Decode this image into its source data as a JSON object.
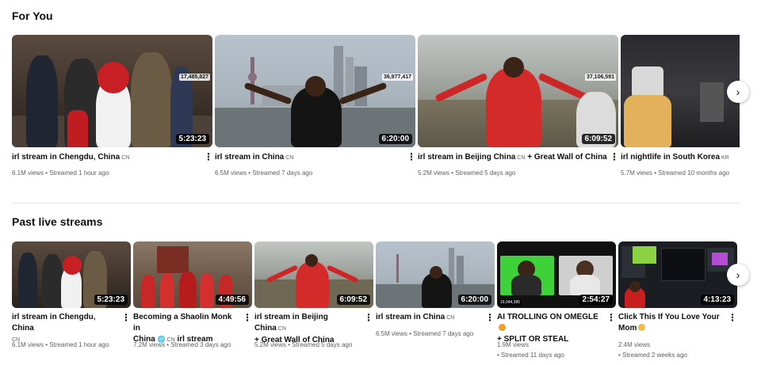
{
  "sections": {
    "for_you": {
      "title": "For You",
      "videos": [
        {
          "title": "irl stream in Chengdu, China",
          "country": "CN",
          "duration": "5:23:23",
          "counter": "17,485,827",
          "meta": "6.1M views • Streamed 1 hour ago"
        },
        {
          "title": "irl stream in China",
          "country": "CN",
          "duration": "6:20:00",
          "counter": "36,977,417",
          "meta": "6.5M views • Streamed 7 days ago"
        },
        {
          "title": "irl stream in Beijing China",
          "country": "CN",
          "title_rest": "+ Great Wall of China",
          "duration": "6:09:52",
          "counter": "37,106,591",
          "meta": "5.2M views • Streamed 5 days ago"
        },
        {
          "title": "irl nightlife in South Korea",
          "country": "KR",
          "meta": "5.7M views • Streamed 10 months ago"
        }
      ]
    },
    "past_live": {
      "title": "Past live streams",
      "videos": [
        {
          "title": "irl stream in Chengdu, China",
          "country": "CN",
          "duration": "5:23:23",
          "meta": "6.1M views • Streamed 1 hour ago"
        },
        {
          "title_a": "Becoming a Shaolin Monk in",
          "title_b": "China",
          "globe": "🌐",
          "country": "CN",
          "title_c": "irl stream",
          "duration": "4:49:56",
          "meta": "7.2M views • Streamed 3 days ago"
        },
        {
          "title": "irl stream in Beijing China",
          "country": "CN",
          "title_rest": "+ Great Wall of China",
          "duration": "6:09:52",
          "meta": "5.2M views • Streamed 5 days ago"
        },
        {
          "title": "irl stream in China",
          "country": "CN",
          "duration": "6:20:00",
          "meta": "6.5M views • Streamed 7 days ago"
        },
        {
          "title": "AI TROLLING ON OMEGLE",
          "title_rest": "+ SPLIT OR STEAL",
          "duration": "2:54:27",
          "counter": "16,044,385",
          "views": "1.9M views",
          "streamed": "• Streamed 11 days ago"
        },
        {
          "title": "Click This If You Love Your Mom",
          "duration": "4:13:23",
          "views": "2.4M views",
          "streamed": "• Streamed 2 weeks ago"
        }
      ]
    }
  },
  "icons": {
    "more": "⋮",
    "next": "›"
  }
}
